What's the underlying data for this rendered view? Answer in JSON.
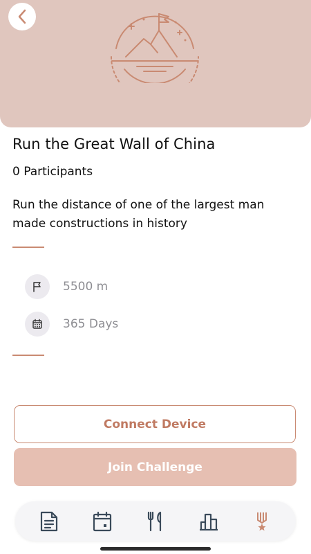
{
  "nav": {
    "back_icon": "chevron-left-icon"
  },
  "hero": {
    "illustration_icon": "mountain-flag-icon"
  },
  "challenge": {
    "title": "Run the Great Wall of China",
    "participants": "0 Participants",
    "description": "Run the distance of one of the largest man made constructions in history"
  },
  "stats": [
    {
      "icon": "flag-icon",
      "value": "5500 m"
    },
    {
      "icon": "calendar-icon",
      "value": "365 Days"
    }
  ],
  "actions": {
    "connect_label": "Connect Device",
    "join_label": "Join Challenge"
  },
  "tabbar": {
    "tabs": [
      {
        "icon": "document-icon",
        "active": false
      },
      {
        "icon": "calendar-icon",
        "active": false
      },
      {
        "icon": "fork-knife-icon",
        "active": false
      },
      {
        "icon": "bar-chart-icon",
        "active": false
      },
      {
        "icon": "medal-icon",
        "active": true
      }
    ]
  },
  "colors": {
    "accent": "#c98a72",
    "hero_bg": "#e0c6be",
    "join_bg": "#e6bfb2",
    "tab_icon": "#3a4a5a"
  }
}
